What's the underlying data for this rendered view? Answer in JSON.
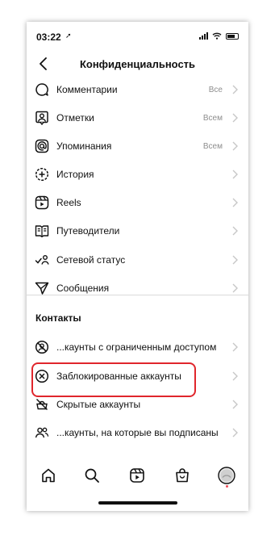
{
  "status_bar": {
    "time": "03:22",
    "location_glyph": "➚"
  },
  "header": {
    "title": "Конфиденциальность"
  },
  "rows": [
    {
      "icon": "comment-icon",
      "label": "Комментарии",
      "value": "Все"
    },
    {
      "icon": "tag-person-icon",
      "label": "Отметки",
      "value": "Всем"
    },
    {
      "icon": "at-icon",
      "label": "Упоминания",
      "value": "Всем"
    },
    {
      "icon": "story-add-icon",
      "label": "История",
      "value": ""
    },
    {
      "icon": "reels-icon",
      "label": "Reels",
      "value": ""
    },
    {
      "icon": "guide-book-icon",
      "label": "Путеводители",
      "value": ""
    },
    {
      "icon": "activity-status-icon",
      "label": "Сетевой статус",
      "value": ""
    },
    {
      "icon": "paper-plane-icon",
      "label": "Сообщения",
      "value": ""
    }
  ],
  "contacts": {
    "header": "Контакты",
    "rows": [
      {
        "icon": "restricted-icon",
        "label": "...каунты с ограниченным доступом"
      },
      {
        "icon": "blocked-icon",
        "label": "Заблокированные аккаунты"
      },
      {
        "icon": "muted-icon",
        "label": "Скрытые аккаунты"
      },
      {
        "icon": "following-icon",
        "label": "...каунты, на которые вы подписаны"
      }
    ]
  },
  "tab_bar": [
    "home-icon",
    "search-icon",
    "reels-tab-icon",
    "shop-icon",
    "profile-avatar"
  ],
  "colors": {
    "highlight": "#e0262c",
    "secondary_text": "#8e8e8e",
    "divider": "#dbdbdb"
  }
}
